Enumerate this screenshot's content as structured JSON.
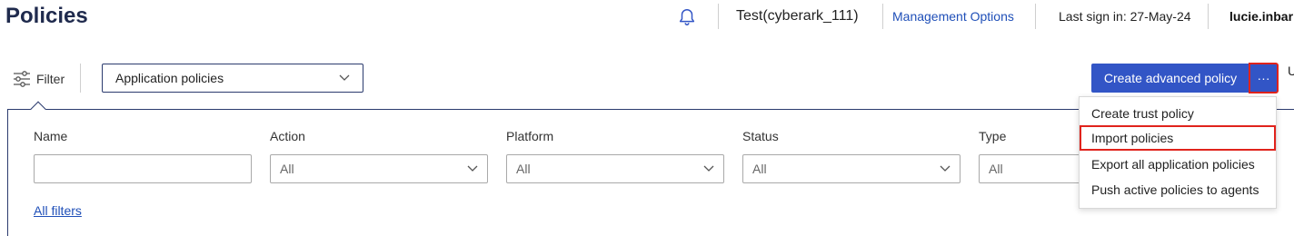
{
  "header": {
    "title": "Policies",
    "tenant": "Test(cyberark_111)",
    "management_options": "Management Options",
    "last_sign_in": "Last sign in: 27-May-24",
    "username": "lucie.inbar"
  },
  "toolbar": {
    "filter_label": "Filter",
    "policy_view_selected": "Application policies",
    "create_button": "Create advanced policy",
    "more_button": "···",
    "truncated_char": "U"
  },
  "filters": {
    "name_label": "Name",
    "name_value": "",
    "action_label": "Action",
    "action_value": "All",
    "platform_label": "Platform",
    "platform_value": "All",
    "status_label": "Status",
    "status_value": "All",
    "type_label": "Type",
    "type_value": "All",
    "all_filters_link": "All filters"
  },
  "more_menu": {
    "items": [
      "Create trust policy",
      "Import policies",
      "Export all application policies",
      "Push active policies to agents"
    ],
    "highlighted_item": "Import policies"
  },
  "colors": {
    "primary": "#3255c6",
    "highlight_outline": "#e0231c",
    "link": "#1f4fb8",
    "title": "#1f2a4d"
  }
}
